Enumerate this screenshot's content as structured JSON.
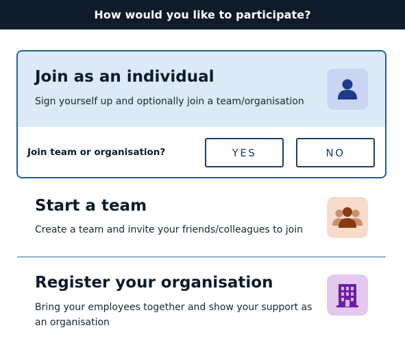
{
  "header": {
    "title": "How would you like to participate?"
  },
  "individual": {
    "title": "Join as an individual",
    "description": "Sign yourself up and optionally join a team/organisation",
    "icon": "person-icon",
    "question": "Join team or organisation?",
    "yes_label": "YES",
    "no_label": "NO"
  },
  "team": {
    "title": "Start a team",
    "description": "Create a team and invite your friends/colleagues to join",
    "icon": "group-icon"
  },
  "organisation": {
    "title": "Register your organisation",
    "description": "Bring your employees together and show your support as an organisation",
    "icon": "building-icon"
  },
  "colors": {
    "header_bg": "#0f1b2a",
    "selected_border": "#1d5fa0",
    "selected_bg": "#dbeaf6",
    "person_tile": "#cbd4f3",
    "group_tile": "#f8dccb",
    "building_tile": "#e5c8f0"
  }
}
